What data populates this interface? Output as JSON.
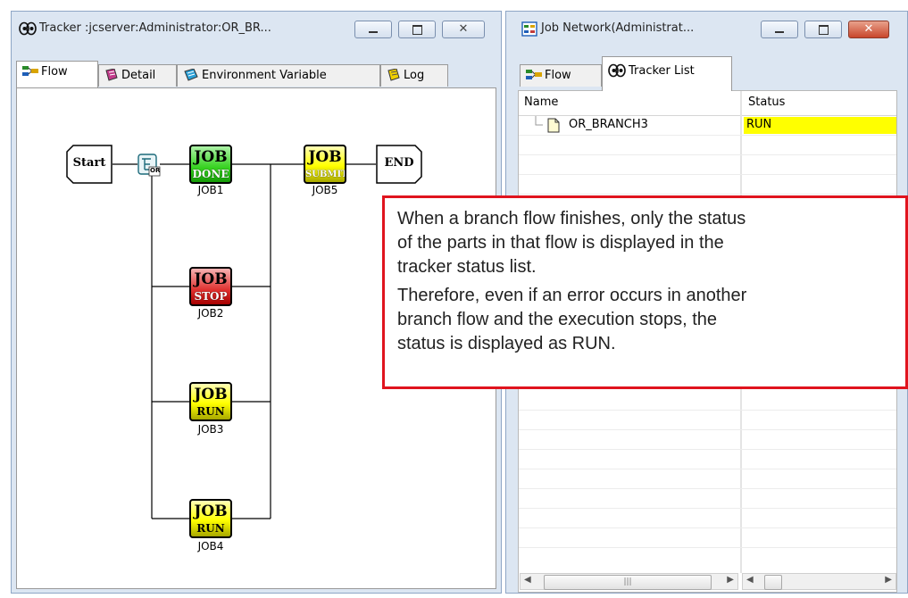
{
  "left_window": {
    "title": "Tracker :jcserver:Administrator:OR_BR...",
    "tabs": [
      {
        "label": "Flow",
        "icon": "flow-icon"
      },
      {
        "label": "Detail",
        "icon": "detail-icon"
      },
      {
        "label": "Environment Variable",
        "icon": "environment-variable-icon"
      },
      {
        "label": "Log",
        "icon": "log-icon"
      }
    ],
    "flow": {
      "start_label": "Start",
      "end_label": "END",
      "branch_icon_text": "OR",
      "jobs": [
        {
          "name": "JOB1",
          "box_text": "JOB",
          "status_text": "DONE"
        },
        {
          "name": "JOB5",
          "box_text": "JOB",
          "status_text": "SUBMIT"
        },
        {
          "name": "JOB2",
          "box_text": "JOB",
          "status_text": "STOP"
        },
        {
          "name": "JOB3",
          "box_text": "JOB",
          "status_text": "RUN"
        },
        {
          "name": "JOB4",
          "box_text": "JOB",
          "status_text": "RUN"
        }
      ]
    }
  },
  "right_window": {
    "title": "Job Network(Administrat...",
    "tabs": [
      {
        "label": "Flow",
        "icon": "flow-icon"
      },
      {
        "label": "Tracker List",
        "icon": "tracker-icon"
      }
    ],
    "columns": [
      "Name",
      "Status"
    ],
    "rows": [
      {
        "name": "OR_BRANCH3",
        "status": "RUN"
      }
    ],
    "status_highlight_color": "#ffff00"
  },
  "callout": {
    "paragraph1": [
      "When a branch flow finishes, only the status",
      "of the parts in that flow is displayed in the",
      "tracker status list."
    ],
    "paragraph2": [
      "Therefore, even if an error occurs in another",
      "branch flow and the execution stops, the",
      "status is displayed as RUN."
    ],
    "border_color": "#e0141e"
  }
}
